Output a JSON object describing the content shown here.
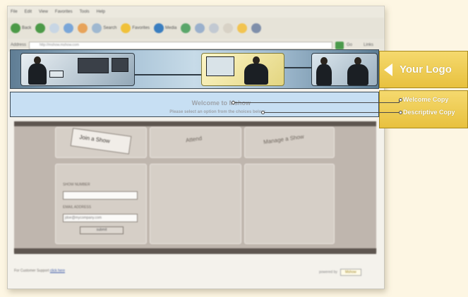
{
  "browser": {
    "menu": [
      "File",
      "Edit",
      "View",
      "Favorites",
      "Tools",
      "Help"
    ],
    "toolbar": {
      "back": "Back",
      "search": "Search",
      "favorites": "Favorites",
      "media": "Media"
    },
    "address_label": "Address",
    "address_value": "http://mshow.mshow.com",
    "go_label": "Go",
    "links_label": "Links"
  },
  "welcome": {
    "title": "Welcome to Mshow",
    "description": "Please select an option from the choices below:"
  },
  "tabs": [
    {
      "label": "Join a Show"
    },
    {
      "label": "Attend"
    },
    {
      "label": "Manage a Show"
    }
  ],
  "login_form": {
    "show_number_label": "SHOW NUMBER",
    "show_number_value": "",
    "email_label": "EMAIL ADDRESS",
    "email_value": "jdoe@mycompany.com",
    "submit_label": "submit"
  },
  "footer": {
    "left_text": "For Customer Support",
    "left_link": "click here",
    "powered_by": "powered by",
    "powered_logo": "Mshow"
  },
  "callouts": {
    "logo": "Your Logo",
    "welcome_copy": "Welcome Copy",
    "descriptive_copy": "Descriptive Copy"
  },
  "colors": {
    "callout_gold": "#e8c13f",
    "banner_blue": "#a7c2d6",
    "welcome_strip": "#c7dff3",
    "page_gray": "#bfb6ae"
  }
}
